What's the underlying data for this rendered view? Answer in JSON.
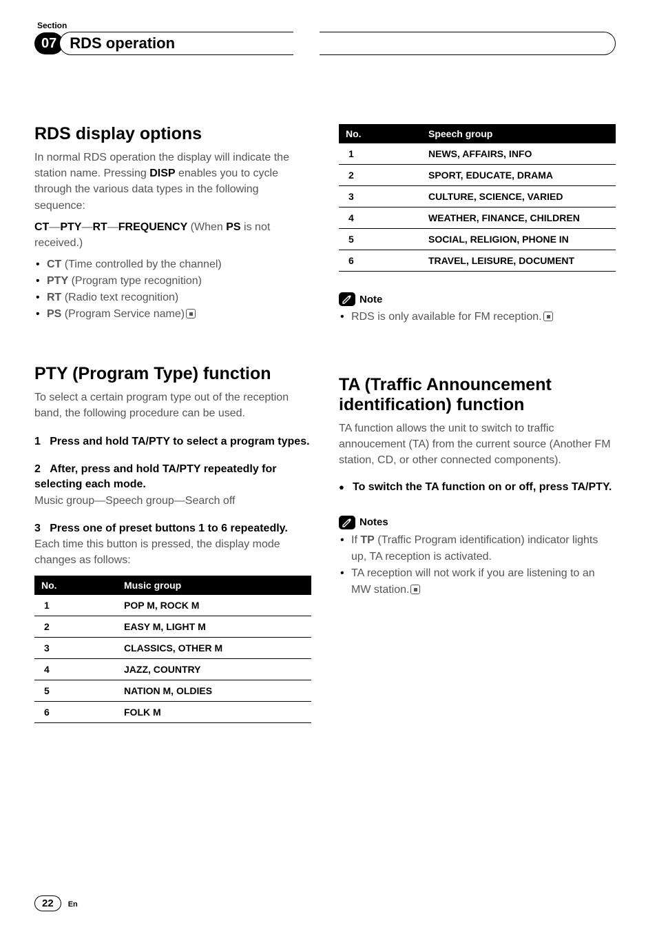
{
  "header": {
    "section_label": "Section",
    "section_number": "07",
    "title": "RDS operation"
  },
  "left": {
    "h1": "RDS display options",
    "intro_part1": "In normal RDS operation the display will indicate the station name. Pressing ",
    "intro_bold1": "DISP",
    "intro_part2": " enables you to cycle through the various data types in the following sequence:",
    "seq_ct": "CT",
    "seq_pty": "PTY",
    "seq_rt": "RT",
    "seq_freq": "FREQUENCY",
    "seq_tail1": " (When ",
    "seq_ps": "PS",
    "seq_tail2": " is not received.)",
    "bullets": [
      {
        "b": "CT",
        "t": " (Time controlled by the channel)"
      },
      {
        "b": "PTY",
        "t": " (Program type recognition)"
      },
      {
        "b": "RT",
        "t": " (Radio text recognition)"
      },
      {
        "b": "PS",
        "t": " (Program Service name)"
      }
    ],
    "h2": "PTY (Program Type) function",
    "pty_intro": "To select a certain program type out of the reception band, the following procedure can be used.",
    "step1_num": "1",
    "step1": "Press and hold TA/PTY to select a program types.",
    "step2_num": "2",
    "step2": "After, press and hold TA/PTY repeatedly for selecting each mode.",
    "step2_body": "Music group—Speech group—Search off",
    "step3_num": "3",
    "step3": "Press one of preset buttons 1 to 6 repeatedly.",
    "step3_body": "Each time this button is pressed, the display mode changes as follows:",
    "music_table": {
      "col1": "No.",
      "col2": "Music group",
      "rows": [
        [
          "1",
          "POP M, ROCK M"
        ],
        [
          "2",
          "EASY M, LIGHT M"
        ],
        [
          "3",
          "CLASSICS, OTHER M"
        ],
        [
          "4",
          "JAZZ, COUNTRY"
        ],
        [
          "5",
          "NATION M, OLDIES"
        ],
        [
          "6",
          "FOLK M"
        ]
      ]
    }
  },
  "right": {
    "speech_table": {
      "col1": "No.",
      "col2": "Speech group",
      "rows": [
        [
          "1",
          "NEWS, AFFAIRS, INFO"
        ],
        [
          "2",
          "SPORT, EDUCATE, DRAMA"
        ],
        [
          "3",
          "CULTURE, SCIENCE, VARIED"
        ],
        [
          "4",
          "WEATHER, FINANCE, CHILDREN"
        ],
        [
          "5",
          "SOCIAL, RELIGION, PHONE IN"
        ],
        [
          "6",
          "TRAVEL, LEISURE, DOCUMENT"
        ]
      ]
    },
    "note_label": "Note",
    "note_body": "RDS is only available for FM reception.",
    "h3": "TA (Traffic Announcement identification) function",
    "ta_intro": "TA function allows the unit to switch to traffic annoucement (TA) from the current source (Another FM station, CD, or other connected components).",
    "ta_action": "To switch the TA function on or off, press TA/PTY.",
    "notes_label": "Notes",
    "note_items": [
      {
        "pre": "If ",
        "b": "TP",
        "post": " (Traffic Program identification) indicator lights up, TA reception is activated."
      },
      {
        "pre": "TA reception will not work if you are listening to an MW station.",
        "b": "",
        "post": ""
      }
    ]
  },
  "footer": {
    "page": "22",
    "lang": "En"
  }
}
